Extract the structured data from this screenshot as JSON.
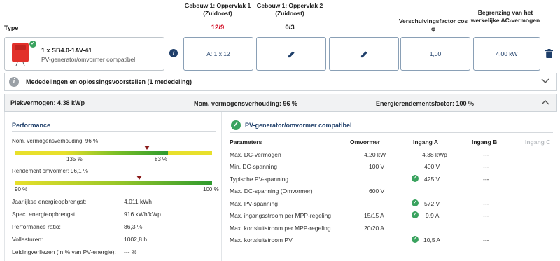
{
  "header": {
    "type_label": "Type",
    "col1": "Gebouw 1: Oppervlak 1 (Zuidoost)",
    "col1_count": "12/9",
    "col2": "Gebouw 1: Oppervlak 2 (Zuidoost)",
    "col2_count": "0/3",
    "col3": "Verschuivingsfactor cos φ",
    "col4": "Begrenzing van het werkelijke AC-vermogen"
  },
  "inverter": {
    "name": "1 x SB4.0-1AV-41",
    "status": "PV-generator/omvormer compatibel",
    "field1": "A: 1 x 12",
    "field3": "1,00",
    "field4": "4,00 kW"
  },
  "notices": {
    "label": "Mededelingen en oplossingsvoorstellen (1 mededeling)"
  },
  "summary": {
    "peak": "Piekvermogen: 4,38 kWp",
    "ratio": "Nom. vermogensverhouding: 96 %",
    "energy": "Energierendementsfactor: 100 %"
  },
  "performance": {
    "title": "Performance",
    "nom_label": "Nom. vermogensverhouding: 96 %",
    "nom_left": "135 %",
    "nom_right": "83 %",
    "nom_marker": 0.96,
    "eff_label": "Rendement omvormer: 96,1 %",
    "eff_left": "90 %",
    "eff_right": "100 %",
    "eff_marker": 0.961,
    "rows": [
      {
        "label": "Jaarlijkse energieopbrengst:",
        "value": "4.011 kWh"
      },
      {
        "label": "Spec. energieopbrengst:",
        "value": "916 kWh/kWp"
      },
      {
        "label": "Performance ratio:",
        "value": "86,3 %"
      },
      {
        "label": "Vollasturen:",
        "value": "1002,8 h"
      },
      {
        "label": "Leidingverliezen (in % van PV-energie):",
        "value": "--- %"
      }
    ]
  },
  "params": {
    "title": "PV-generator/omvormer compatibel",
    "head": {
      "param": "Parameters",
      "omvormer": "Omvormer",
      "a": "Ingang A",
      "b": "Ingang B",
      "c": "Ingang C"
    },
    "rows": [
      {
        "name": "Max. DC-vermogen",
        "omv": "4,20 kW",
        "a": "4,38 kWp",
        "b": "---",
        "check": false
      },
      {
        "name": "Min. DC-spanning",
        "omv": "100 V",
        "a": "400 V",
        "b": "---",
        "check": false
      },
      {
        "name": "Typische PV-spanning",
        "omv": "",
        "a": "425 V",
        "b": "---",
        "check": true
      },
      {
        "name": "Max. DC-spanning (Omvormer)",
        "omv": "600 V",
        "a": "",
        "b": "",
        "check": false
      },
      {
        "name": "Max. PV-spanning",
        "omv": "",
        "a": "572 V",
        "b": "---",
        "check": true
      },
      {
        "name": "Max. ingangsstroom per MPP-regeling",
        "omv": "15/15 A",
        "a": "9,9 A",
        "b": "---",
        "check": true
      },
      {
        "name": "Max. kortsluitstroom per MPP-regeling",
        "omv": "20/20 A",
        "a": "",
        "b": "",
        "check": false
      },
      {
        "name": "Max. kortsluitstroom PV",
        "omv": "",
        "a": "10,5 A",
        "b": "---",
        "check": true
      }
    ]
  },
  "colors": {
    "accent": "#1f3f6a",
    "red": "#d0021b",
    "green": "#3aa35f",
    "inverter": "#e2312b"
  }
}
